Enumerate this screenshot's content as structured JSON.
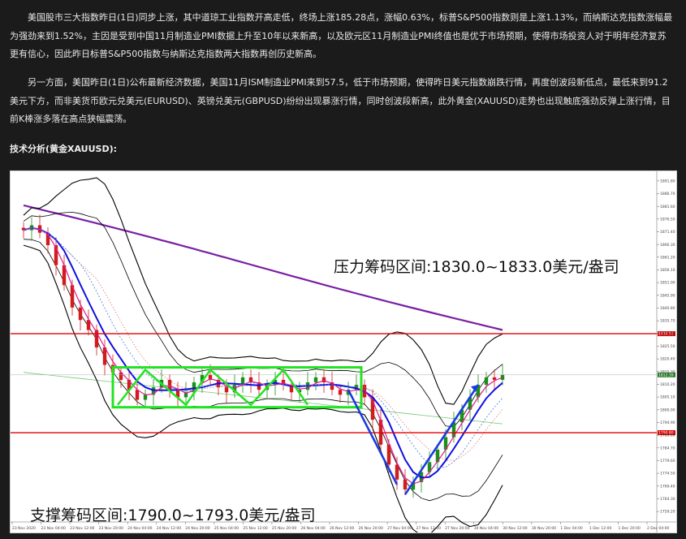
{
  "article": {
    "para1": "美国股市三大指数昨日(1日)同步上涨，其中道琼工业指数开高走低，终场上涨185.28点，涨幅0.63%，标普S&P500指数则是上涨1.13%，而纳斯达克指数涨幅最为强劲来到1.52%，主因是受到中国11月制造业PMI数据上升至10年以来新高，以及欧元区11月制造业PMI终值也是优于市场预期，使得市场投资人对于明年经济复苏更有信心，因此昨日标普S&P500指数与纳斯达克指数两大指数再创历史新高。",
    "para2": "另一方面，美国昨日(1日)公布最新经济数据，美国11月ISM制造业PMI来到57.5，低于市场预期，使得昨日美元指数崩跌行情，再度创波段新低点，最低来到91.2美元下方，而非美货币欧元兑美元(EURUSD)、英镑兑美元(GBPUSD)纷纷出现暴涨行情，同时创波段新高，此外黄金(XAUUSD)走势也出现触底强劲反弹上涨行情，目前K棒涨多落在高点狭幅震荡。",
    "heading": "技术分析(黄金XAUUSD):"
  },
  "chart_data": {
    "type": "candlestick",
    "symbol": "XAUUSD",
    "annotations": {
      "resistance": "压力筹码区间:1830.0~1833.0美元/盎司",
      "support": "支撑筹码区间:1790.0~1793.0美元/盎司"
    },
    "resistance_level": 1830.5,
    "support_level": 1790.8,
    "price_axis_range": [
      1755,
      1895
    ],
    "price_ticks": [
      "1891.80",
      "1886.70",
      "1881.60",
      "1876.50",
      "1871.40",
      "1866.30",
      "1861.20",
      "1856.10",
      "1851.00",
      "1845.90",
      "1840.80",
      "1835.70",
      "1830.60",
      "1825.50",
      "1820.40",
      "1815.30",
      "1810.20",
      "1805.10",
      "1800.00",
      "1794.90",
      "1789.80",
      "1784.70",
      "1779.60",
      "1774.50",
      "1769.40",
      "1764.30",
      "1759.20"
    ],
    "resistance_tag": "1830.52",
    "support_tag": "1790.80",
    "last_price_tag": "1812.39",
    "time_ticks": [
      "23 Nov 2020",
      "23 Nov 04:00",
      "23 Nov 12:00",
      "23 Nov 20:00",
      "24 Nov 04:00",
      "24 Nov 12:00",
      "24 Nov 20:00",
      "25 Nov 04:00",
      "25 Nov 12:00",
      "25 Nov 20:00",
      "26 Nov 04:00",
      "26 Nov 12:00",
      "26 Nov 20:00",
      "27 Nov 04:00",
      "27 Nov 12:00",
      "27 Nov 20:00",
      "30 Nov 04:00",
      "30 Nov 12:00",
      "30 Nov 20:00",
      "1 Dec 04:00",
      "1 Dec 12:00",
      "1 Dec 20:00",
      "2 Dec 04:00"
    ],
    "close_series": [
      1872,
      1874,
      1871,
      1866,
      1858,
      1850,
      1841,
      1836,
      1832,
      1825,
      1818,
      1815,
      1812,
      1808,
      1804,
      1806,
      1809,
      1812,
      1808,
      1805,
      1807,
      1811,
      1814,
      1812,
      1809,
      1807,
      1810,
      1813,
      1811,
      1808,
      1810,
      1812,
      1810,
      1807,
      1808,
      1811,
      1813,
      1811,
      1808,
      1806,
      1808,
      1810,
      1805,
      1796,
      1786,
      1778,
      1772,
      1768,
      1771,
      1775,
      1779,
      1784,
      1789,
      1795,
      1800,
      1805,
      1810,
      1813,
      1812,
      1814
    ],
    "colors": {
      "up_candle": "#1a8f1a",
      "down_candle": "#d21b1b",
      "ma_long": "#7a1fa2",
      "bollinger": "#000000",
      "fast_ma": "#1010e0",
      "signal": "#e2188e",
      "consolidation_box": "#22e322",
      "level_line": "#e00000"
    }
  }
}
